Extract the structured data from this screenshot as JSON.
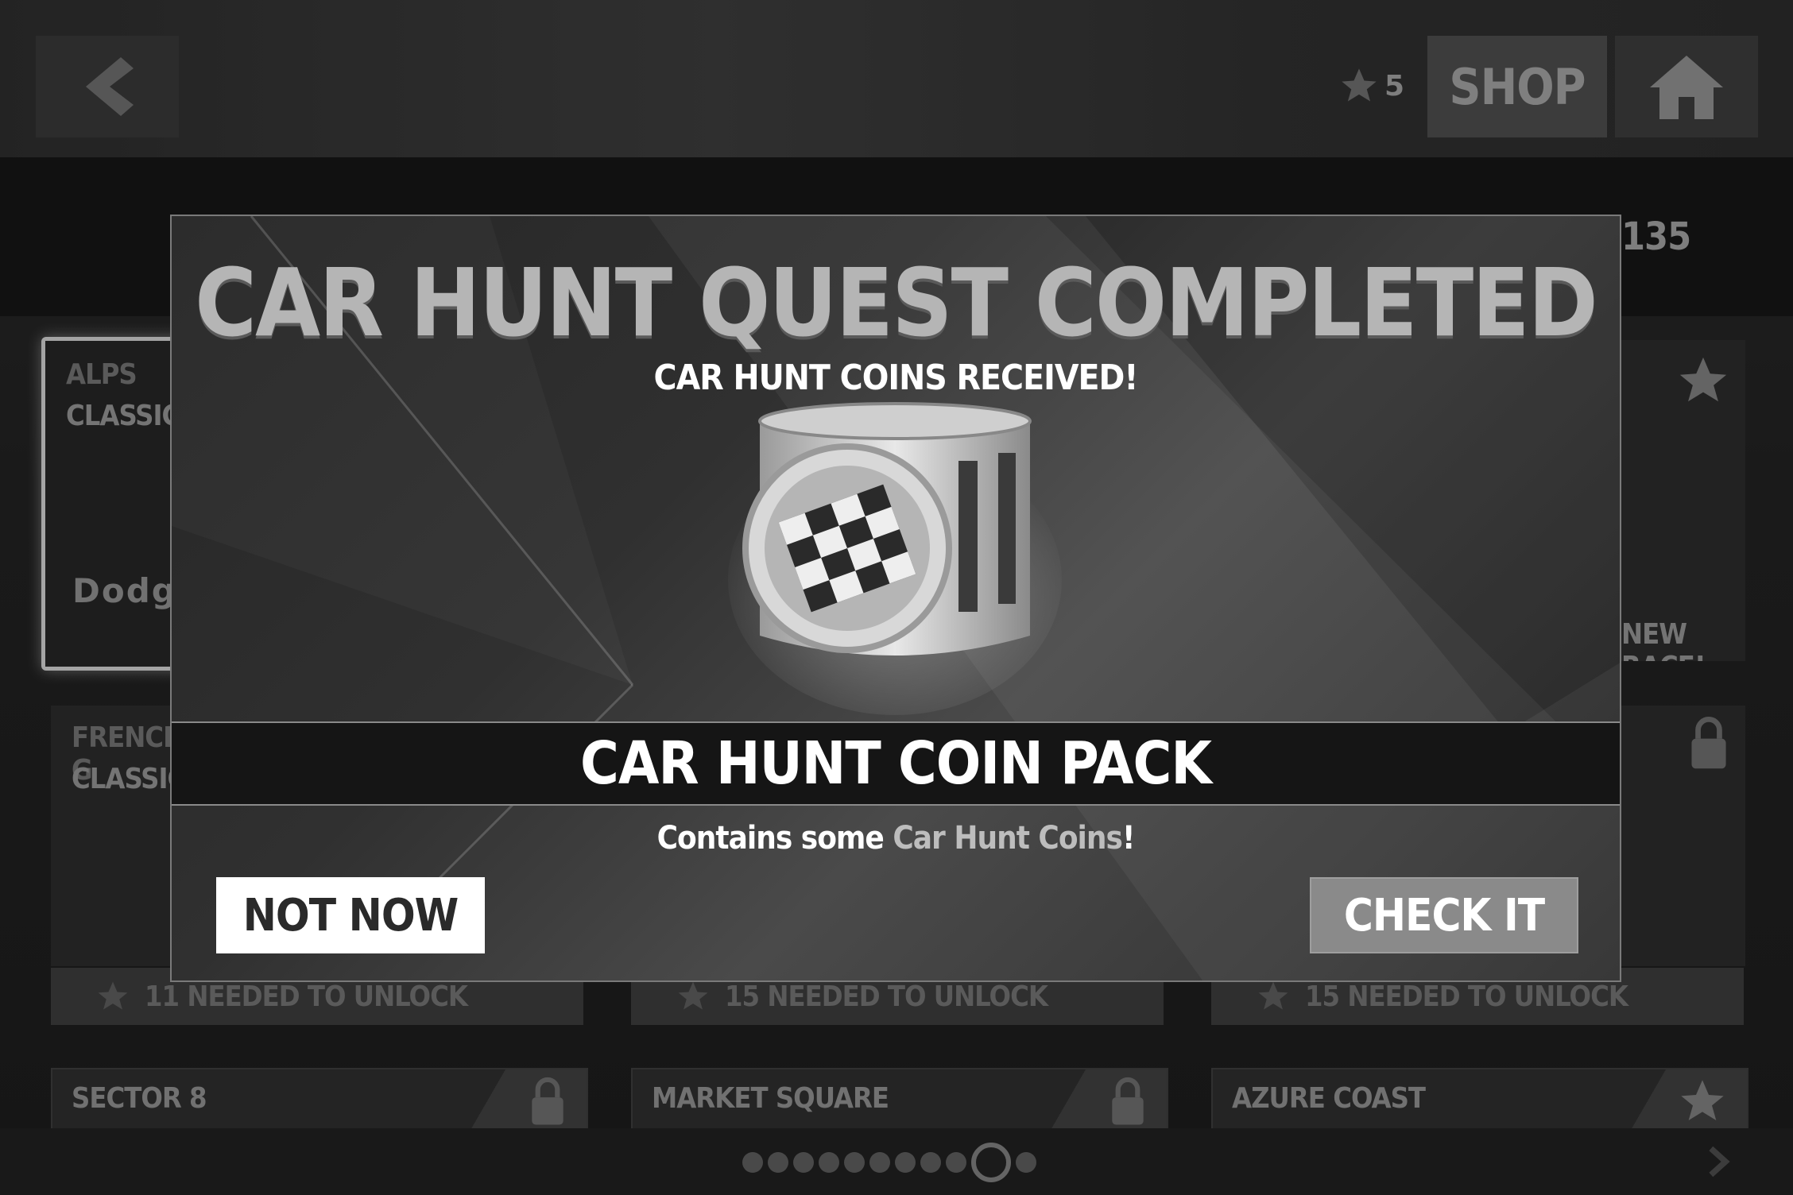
{
  "topbar": {
    "star_count": "5",
    "shop_label": "SHOP",
    "score_fragment": "135"
  },
  "cards": {
    "alps": {
      "line1": "ALPS",
      "line2": "CLASSIC",
      "brand": "Dodge"
    },
    "french": {
      "line1": "FRENCH G",
      "line2": "CLASSIC"
    },
    "right_top": {
      "label": "NEW RACE!"
    },
    "unlock": [
      {
        "text": "11 NEEDED TO UNLOCK"
      },
      {
        "text": "15 NEEDED TO UNLOCK"
      },
      {
        "text": "15 NEEDED TO UNLOCK"
      }
    ]
  },
  "tracks": [
    {
      "label": "SECTOR 8",
      "icon": "lock-icon"
    },
    {
      "label": "MARKET SQUARE",
      "icon": "lock-icon"
    },
    {
      "label": "AZURE COAST",
      "icon": "star-icon"
    }
  ],
  "pagination": {
    "count": 11,
    "active_index": 9
  },
  "modal": {
    "title": "CAR HUNT QUEST COMPLETED",
    "subtitle": "CAR HUNT COINS RECEIVED!",
    "item_name": "CAR HUNT COIN PACK",
    "desc_prefix": "Contains some ",
    "desc_highlight": "Car Hunt Coins",
    "desc_suffix": "!",
    "not_now_label": "NOT NOW",
    "check_label": "CHECK IT"
  },
  "colors": {
    "accent": "#8a8a8a",
    "highlight_text": "#bdbdbd"
  }
}
